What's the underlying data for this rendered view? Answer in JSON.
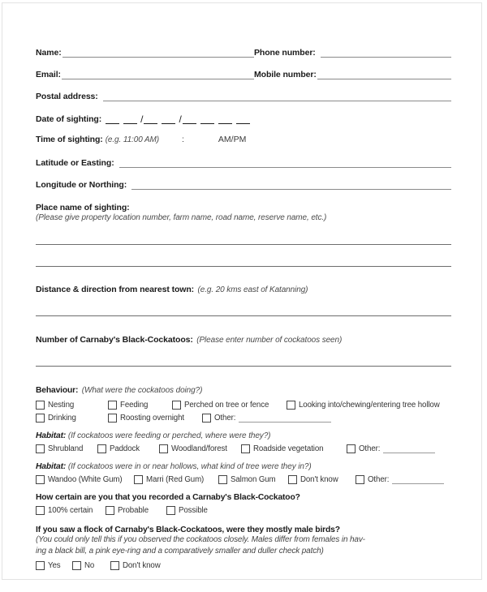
{
  "form": {
    "contact": [
      {
        "left_label": "Name:",
        "right_label": "Phone number:"
      },
      {
        "left_label": "Email:",
        "right_label": "Mobile number:"
      }
    ],
    "postal_label": "Postal address:",
    "date_label": "Date of sighting:",
    "date_separator": "/",
    "time_label": "Time of sighting:",
    "time_hint": "(e.g. 11:00 AM)",
    "time_colon": ":",
    "time_ampm": "AM/PM",
    "latitude_label": "Latitude or Easting:",
    "longitude_label": "Longitude or Northing:",
    "place_label": "Place name of sighting:",
    "place_hint": "(Please give property location number, farm name, road name, reserve name, etc.)",
    "distance_label": "Distance & direction from nearest town:",
    "distance_hint": "(e.g. 20 kms east of Katanning)",
    "number_label": "Number of Carnaby's Black-Cockatoos:",
    "number_hint": "(Please enter number of cockatoos seen)"
  },
  "behaviour": {
    "label": "Behaviour:",
    "hint": "(What were the cockatoos doing?)",
    "row1": [
      "Nesting",
      "Feeding",
      "Perched on tree or fence",
      "Looking into/chewing/entering tree hollow"
    ],
    "row2": [
      "Drinking",
      "Roosting overnight"
    ],
    "other_label": "Other:"
  },
  "habitat_perched": {
    "label": "Habitat:",
    "hint": "(If cockatoos were feeding or perched, where were they?)",
    "options": [
      "Shrubland",
      "Paddock",
      "Woodland/forest",
      "Roadside vegetation"
    ],
    "other_label": "Other:"
  },
  "habitat_hollow": {
    "label": "Habitat:",
    "hint": "(If cockatoos were in or near hollows, what kind of tree were they in?)",
    "options": [
      "Wandoo (White Gum)",
      "Marri (Red Gum)",
      "Salmon Gum",
      "Don't know"
    ],
    "other_label": "Other:"
  },
  "certainty": {
    "question": "How certain are you that you recorded a Carnaby's Black-Cockatoo?",
    "options": [
      "100% certain",
      "Probable",
      "Possible"
    ]
  },
  "flock": {
    "question": "If you saw a flock of Carnaby's Black-Cockatoos, were they mostly male birds?",
    "note_line1": "(You could only tell this if you observed the cockatoos closely. Males differ from females in hav-",
    "note_line2": "ing a black bill, a pink eye-ring and a comparatively smaller and duller check patch)",
    "options": [
      "Yes",
      "No",
      "Don't know"
    ]
  }
}
